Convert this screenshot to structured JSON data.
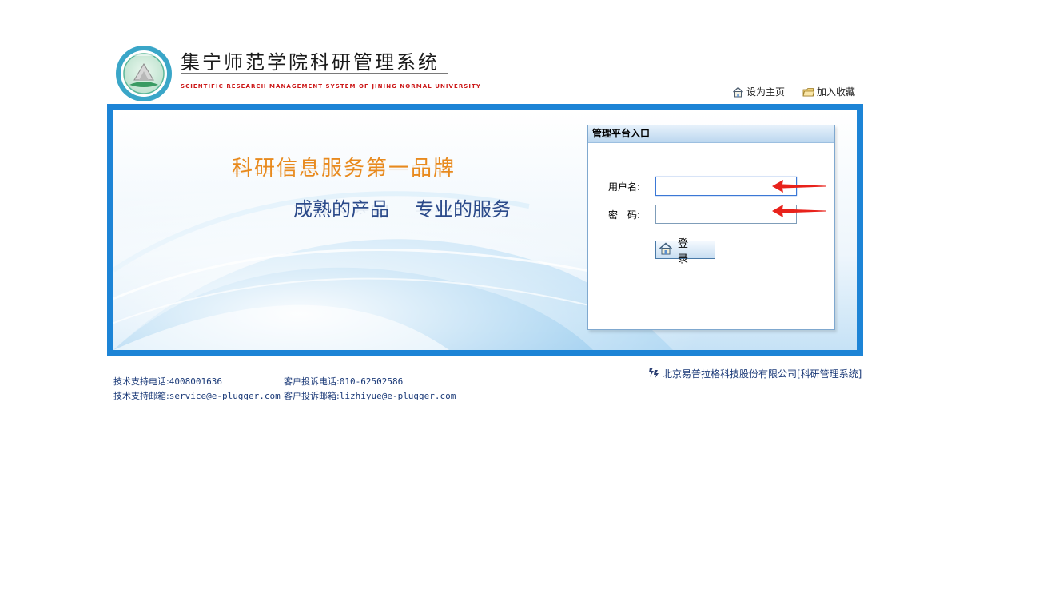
{
  "header": {
    "title_cn": "集宁师范学院科研管理系统",
    "title_en": "SCIENTIFIC RESEARCH MANAGEMENT SYSTEM OF JINING NORMAL UNIVERSITY",
    "set_home_label": "设为主页",
    "add_favorite_label": "加入收藏"
  },
  "banner": {
    "slogan1": "科研信息服务第一品牌",
    "slogan2_part1": "成熟的产品",
    "slogan2_part2": "专业的服务"
  },
  "login": {
    "title": "管理平台入口",
    "username_label": "用户名:",
    "password_label": "密　码:",
    "username_value": "",
    "password_value": "",
    "submit_label": "登 录"
  },
  "footer": {
    "tech_phone_label": "技术支持电话:",
    "tech_phone": "4008001636",
    "complaint_phone_label": "客户投诉电话:",
    "complaint_phone": "010-62502586",
    "tech_email_label": "技术支持邮箱:",
    "tech_email": "service@e-plugger.com",
    "complaint_email_label": "客户投诉邮箱:",
    "complaint_email": "lizhiyue@e-plugger.com",
    "company": "北京易普拉格科技股份有限公司[科研管理系统]"
  },
  "colors": {
    "banner_border": "#1d84d6",
    "slogan_orange": "#e88a1e",
    "slogan_blue": "#2b4a8a",
    "footer_text": "#1b3a78",
    "arrow_red": "#e8221b"
  },
  "icons": {
    "set_home": "house-icon",
    "favorite": "folder-icon",
    "login_button": "house-icon",
    "company_logo": "ep-logo-icon"
  }
}
